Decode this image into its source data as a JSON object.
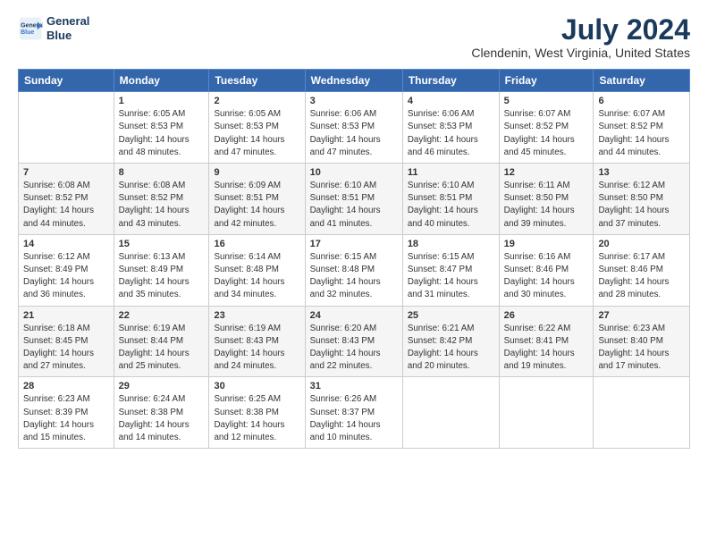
{
  "header": {
    "logo_line1": "General",
    "logo_line2": "Blue",
    "title": "July 2024",
    "subtitle": "Clendenin, West Virginia, United States"
  },
  "columns": [
    "Sunday",
    "Monday",
    "Tuesday",
    "Wednesday",
    "Thursday",
    "Friday",
    "Saturday"
  ],
  "weeks": [
    [
      {
        "day": "",
        "detail": ""
      },
      {
        "day": "1",
        "detail": "Sunrise: 6:05 AM\nSunset: 8:53 PM\nDaylight: 14 hours\nand 48 minutes."
      },
      {
        "day": "2",
        "detail": "Sunrise: 6:05 AM\nSunset: 8:53 PM\nDaylight: 14 hours\nand 47 minutes."
      },
      {
        "day": "3",
        "detail": "Sunrise: 6:06 AM\nSunset: 8:53 PM\nDaylight: 14 hours\nand 47 minutes."
      },
      {
        "day": "4",
        "detail": "Sunrise: 6:06 AM\nSunset: 8:53 PM\nDaylight: 14 hours\nand 46 minutes."
      },
      {
        "day": "5",
        "detail": "Sunrise: 6:07 AM\nSunset: 8:52 PM\nDaylight: 14 hours\nand 45 minutes."
      },
      {
        "day": "6",
        "detail": "Sunrise: 6:07 AM\nSunset: 8:52 PM\nDaylight: 14 hours\nand 44 minutes."
      }
    ],
    [
      {
        "day": "7",
        "detail": "Sunrise: 6:08 AM\nSunset: 8:52 PM\nDaylight: 14 hours\nand 44 minutes."
      },
      {
        "day": "8",
        "detail": "Sunrise: 6:08 AM\nSunset: 8:52 PM\nDaylight: 14 hours\nand 43 minutes."
      },
      {
        "day": "9",
        "detail": "Sunrise: 6:09 AM\nSunset: 8:51 PM\nDaylight: 14 hours\nand 42 minutes."
      },
      {
        "day": "10",
        "detail": "Sunrise: 6:10 AM\nSunset: 8:51 PM\nDaylight: 14 hours\nand 41 minutes."
      },
      {
        "day": "11",
        "detail": "Sunrise: 6:10 AM\nSunset: 8:51 PM\nDaylight: 14 hours\nand 40 minutes."
      },
      {
        "day": "12",
        "detail": "Sunrise: 6:11 AM\nSunset: 8:50 PM\nDaylight: 14 hours\nand 39 minutes."
      },
      {
        "day": "13",
        "detail": "Sunrise: 6:12 AM\nSunset: 8:50 PM\nDaylight: 14 hours\nand 37 minutes."
      }
    ],
    [
      {
        "day": "14",
        "detail": "Sunrise: 6:12 AM\nSunset: 8:49 PM\nDaylight: 14 hours\nand 36 minutes."
      },
      {
        "day": "15",
        "detail": "Sunrise: 6:13 AM\nSunset: 8:49 PM\nDaylight: 14 hours\nand 35 minutes."
      },
      {
        "day": "16",
        "detail": "Sunrise: 6:14 AM\nSunset: 8:48 PM\nDaylight: 14 hours\nand 34 minutes."
      },
      {
        "day": "17",
        "detail": "Sunrise: 6:15 AM\nSunset: 8:48 PM\nDaylight: 14 hours\nand 32 minutes."
      },
      {
        "day": "18",
        "detail": "Sunrise: 6:15 AM\nSunset: 8:47 PM\nDaylight: 14 hours\nand 31 minutes."
      },
      {
        "day": "19",
        "detail": "Sunrise: 6:16 AM\nSunset: 8:46 PM\nDaylight: 14 hours\nand 30 minutes."
      },
      {
        "day": "20",
        "detail": "Sunrise: 6:17 AM\nSunset: 8:46 PM\nDaylight: 14 hours\nand 28 minutes."
      }
    ],
    [
      {
        "day": "21",
        "detail": "Sunrise: 6:18 AM\nSunset: 8:45 PM\nDaylight: 14 hours\nand 27 minutes."
      },
      {
        "day": "22",
        "detail": "Sunrise: 6:19 AM\nSunset: 8:44 PM\nDaylight: 14 hours\nand 25 minutes."
      },
      {
        "day": "23",
        "detail": "Sunrise: 6:19 AM\nSunset: 8:43 PM\nDaylight: 14 hours\nand 24 minutes."
      },
      {
        "day": "24",
        "detail": "Sunrise: 6:20 AM\nSunset: 8:43 PM\nDaylight: 14 hours\nand 22 minutes."
      },
      {
        "day": "25",
        "detail": "Sunrise: 6:21 AM\nSunset: 8:42 PM\nDaylight: 14 hours\nand 20 minutes."
      },
      {
        "day": "26",
        "detail": "Sunrise: 6:22 AM\nSunset: 8:41 PM\nDaylight: 14 hours\nand 19 minutes."
      },
      {
        "day": "27",
        "detail": "Sunrise: 6:23 AM\nSunset: 8:40 PM\nDaylight: 14 hours\nand 17 minutes."
      }
    ],
    [
      {
        "day": "28",
        "detail": "Sunrise: 6:23 AM\nSunset: 8:39 PM\nDaylight: 14 hours\nand 15 minutes."
      },
      {
        "day": "29",
        "detail": "Sunrise: 6:24 AM\nSunset: 8:38 PM\nDaylight: 14 hours\nand 14 minutes."
      },
      {
        "day": "30",
        "detail": "Sunrise: 6:25 AM\nSunset: 8:38 PM\nDaylight: 14 hours\nand 12 minutes."
      },
      {
        "day": "31",
        "detail": "Sunrise: 6:26 AM\nSunset: 8:37 PM\nDaylight: 14 hours\nand 10 minutes."
      },
      {
        "day": "",
        "detail": ""
      },
      {
        "day": "",
        "detail": ""
      },
      {
        "day": "",
        "detail": ""
      }
    ]
  ]
}
